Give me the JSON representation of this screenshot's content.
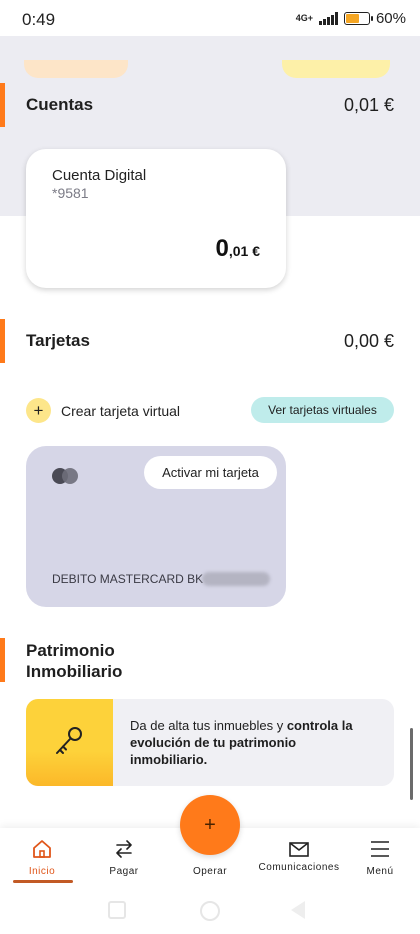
{
  "status_bar": {
    "time": "0:49",
    "network": "4G+",
    "battery": "60%",
    "battery_level": 0.6
  },
  "cuentas": {
    "title": "Cuentas",
    "total": "0,01 €",
    "account": {
      "name": "Cuenta Digital",
      "number": "*9581",
      "balance_int": "0",
      "balance_dec": ",01 €"
    }
  },
  "tarjetas": {
    "title": "Tarjetas",
    "total": "0,00 €",
    "create_label": "Crear tarjeta virtual",
    "create_icon": "plus-icon",
    "view_virtual_label": "Ver tarjetas virtuales",
    "card": {
      "activate_label": "Activar mi tarjeta",
      "card_type": "DEBITO MASTERCARD BK",
      "brand_icon": "mastercard-icon"
    }
  },
  "patrimonio": {
    "title": "Patrimonio Inmobiliario",
    "promo_text_1": "Da de alta tus inmuebles y ",
    "promo_text_bold": "controla la evolución de tu patrimonio inmobiliario.",
    "promo_icon": "key-icon"
  },
  "bottom_nav": {
    "items": [
      {
        "label": "Inicio",
        "icon": "home-icon"
      },
      {
        "label": "Pagar",
        "icon": "transfer-arrows-icon"
      },
      {
        "label": "Operar",
        "icon": "plus-icon"
      },
      {
        "label": "Comunicaciones",
        "icon": "envelope-icon"
      },
      {
        "label": "Menú",
        "icon": "hamburger-icon"
      }
    ],
    "fab_symbol": "+"
  },
  "colors": {
    "accent": "#ff7a1a",
    "active_nav": "#e0561a",
    "teal_button": "#bfeceb",
    "card_gray": "#d6d6e7",
    "promo_yellow": "#fdd23a"
  }
}
